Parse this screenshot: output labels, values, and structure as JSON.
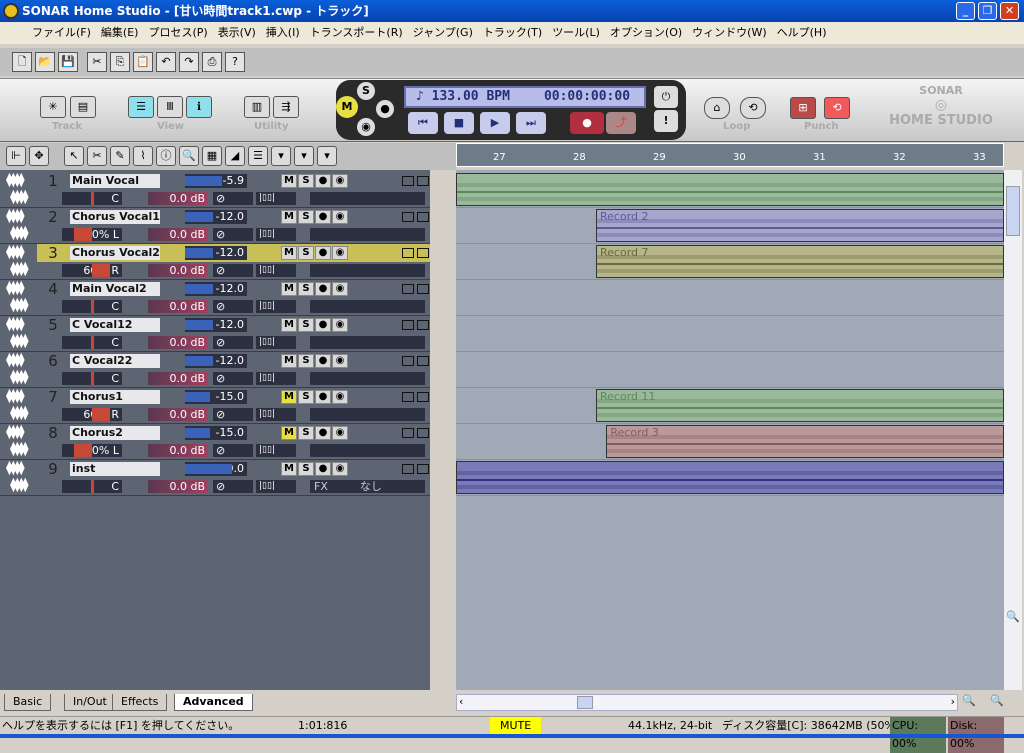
{
  "window": {
    "title": "SONAR Home Studio - [甘い時間track1.cwp - トラック]"
  },
  "menu": [
    "ファイル(F)",
    "編集(E)",
    "プロセス(P)",
    "表示(V)",
    "挿入(I)",
    "トランスポート(R)",
    "ジャンプ(G)",
    "トラック(T)",
    "ツール(L)",
    "オプション(O)",
    "ウィンドウ(W)",
    "ヘルプ(H)"
  ],
  "control": {
    "track_label": "Track",
    "view_label": "View",
    "utility_label": "Utility",
    "loop_label": "Loop",
    "punch_label": "Punch",
    "bpm": "133.00 BPM",
    "time": "00:00:00:00",
    "logo_top": "SONAR",
    "logo_bottom": "HOME STUDIO"
  },
  "tracks": [
    {
      "num": "1",
      "name": "Main Vocal",
      "vol": "-5.9",
      "vol_level": 0.6,
      "pan": "C",
      "pan_pct": 0,
      "gain": "0.0 dB",
      "mute": false,
      "fx": ""
    },
    {
      "num": "2",
      "name": "Chorus Vocal1",
      "vol": "-12.0",
      "vol_level": 0.45,
      "pan": "60% L",
      "pan_pct": -60,
      "gain": "0.0 dB",
      "mute": false,
      "fx": ""
    },
    {
      "num": "3",
      "name": "Chorus Vocal2",
      "vol": "-12.0",
      "vol_level": 0.45,
      "pan": "60% R",
      "pan_pct": 60,
      "gain": "0.0 dB",
      "mute": false,
      "fx": "",
      "selected": true
    },
    {
      "num": "4",
      "name": "Main Vocal2",
      "vol": "-12.0",
      "vol_level": 0.45,
      "pan": "C",
      "pan_pct": 0,
      "gain": "0.0 dB",
      "mute": false,
      "fx": ""
    },
    {
      "num": "5",
      "name": "C Vocal12",
      "vol": "-12.0",
      "vol_level": 0.45,
      "pan": "C",
      "pan_pct": 0,
      "gain": "0.0 dB",
      "mute": false,
      "fx": ""
    },
    {
      "num": "6",
      "name": "C Vocal22",
      "vol": "-12.0",
      "vol_level": 0.45,
      "pan": "C",
      "pan_pct": 0,
      "gain": "0.0 dB",
      "mute": false,
      "fx": ""
    },
    {
      "num": "7",
      "name": "Chorus1",
      "vol": "-15.0",
      "vol_level": 0.4,
      "pan": "60% R",
      "pan_pct": 60,
      "gain": "0.0 dB",
      "mute": true,
      "fx": ""
    },
    {
      "num": "8",
      "name": "Chorus2",
      "vol": "-15.0",
      "vol_level": 0.4,
      "pan": "60% L",
      "pan_pct": -60,
      "gain": "0.0 dB",
      "mute": true,
      "fx": ""
    },
    {
      "num": "9",
      "name": "inst",
      "vol": "0.0",
      "vol_level": 0.75,
      "pan": "C",
      "pan_pct": 0,
      "gain": "0.0 dB",
      "mute": false,
      "fx_label": "FX",
      "fx": "なし"
    }
  ],
  "ruler": [
    "27",
    "28",
    "29",
    "30",
    "31",
    "32",
    "33"
  ],
  "clips": [
    {
      "track": 0,
      "label": "",
      "start": 26.55,
      "color": "#9ab89a",
      "wave": "#5a8a5a"
    },
    {
      "track": 1,
      "label": "Record 2",
      "start": 28.3,
      "color": "#a6a6cc",
      "wave": "#5a5a9a"
    },
    {
      "track": 2,
      "label": "Record 7",
      "start": 28.3,
      "color": "#b6b68a",
      "wave": "#6a6a40"
    },
    {
      "track": 6,
      "label": "Record 11",
      "start": 28.3,
      "color": "#9ab89a",
      "wave": "#5a8a5a"
    },
    {
      "track": 7,
      "label": "Record 3",
      "start": 28.43,
      "color": "#b89a9a",
      "wave": "#8a5a5a"
    },
    {
      "track": 8,
      "label": "",
      "start": 26.55,
      "color": "#7a7ab8",
      "wave": "#303080"
    }
  ],
  "tabs": [
    "Basic",
    "In/Out",
    "Effects",
    "Advanced"
  ],
  "active_tab": "Advanced",
  "status": {
    "help": "ヘルプを表示するには [F1] を押してください。",
    "time": "1:01:816",
    "mute": "MUTE",
    "format": "44.1kHz, 24-bit",
    "disk_space": "ディスク容量[C]: 38642MB (50%)",
    "cpu": "CPU: 00%",
    "disk": "Disk: 00%"
  }
}
